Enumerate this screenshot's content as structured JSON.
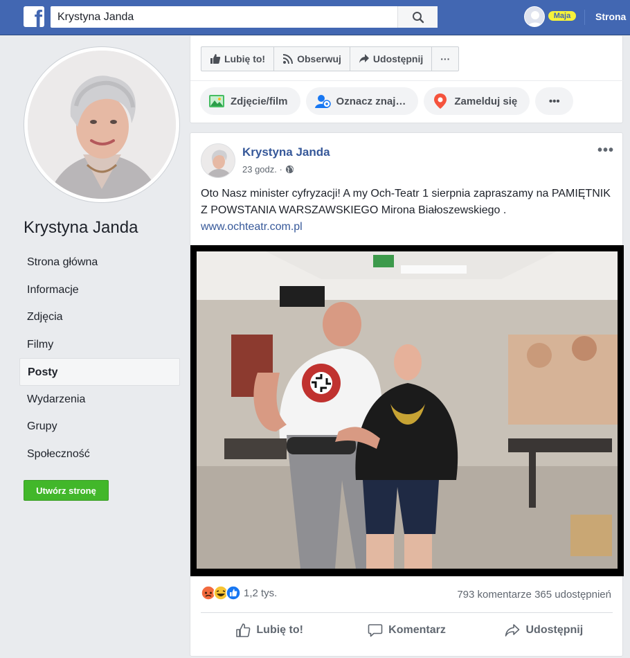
{
  "topbar": {
    "logo": "f",
    "search_value": "Krystyna Janda",
    "search_icon": "search-icon",
    "user_name": "Maja",
    "nav_label": "Strona"
  },
  "sidebar": {
    "page_name": "Krystyna Janda",
    "items": [
      {
        "label": "Strona główna"
      },
      {
        "label": "Informacje"
      },
      {
        "label": "Zdjęcia"
      },
      {
        "label": "Filmy"
      },
      {
        "label": "Posty"
      },
      {
        "label": "Wydarzenia"
      },
      {
        "label": "Grupy"
      },
      {
        "label": "Społeczność"
      }
    ],
    "active_item": "Posty",
    "create_page_label": "Utwórz stronę"
  },
  "actions": {
    "like": "Lubię to!",
    "follow": "Obserwuj",
    "share": "Udostępnij",
    "more": "···"
  },
  "composer": {
    "photo": "Zdjęcie/film",
    "tag": "Oznacz znaj…",
    "checkin": "Zamelduj się",
    "more": "•••"
  },
  "post": {
    "author": "Krystyna Janda",
    "time": "23 godz. ·",
    "more": "•••",
    "text": "Oto Nasz minister cyfryzacji! A my Och-Teatr 1 sierpnia zapraszamy na PAMIĘTNIK Z POWSTANIA WARSZAWSKIEGO Mirona Białoszewskiego .",
    "link": "www.ochteatr.com.pl",
    "reactions_count": "1,2 tys.",
    "comments": "793 komentarze",
    "shares": "365 udostępnień",
    "like_action": "Lubię to!",
    "comment_action": "Komentarz",
    "share_action": "Udostępnij"
  },
  "colors": {
    "topbar": "#4267b2",
    "link": "#365899",
    "create_button": "#42b72a",
    "background": "#e9ebee"
  }
}
